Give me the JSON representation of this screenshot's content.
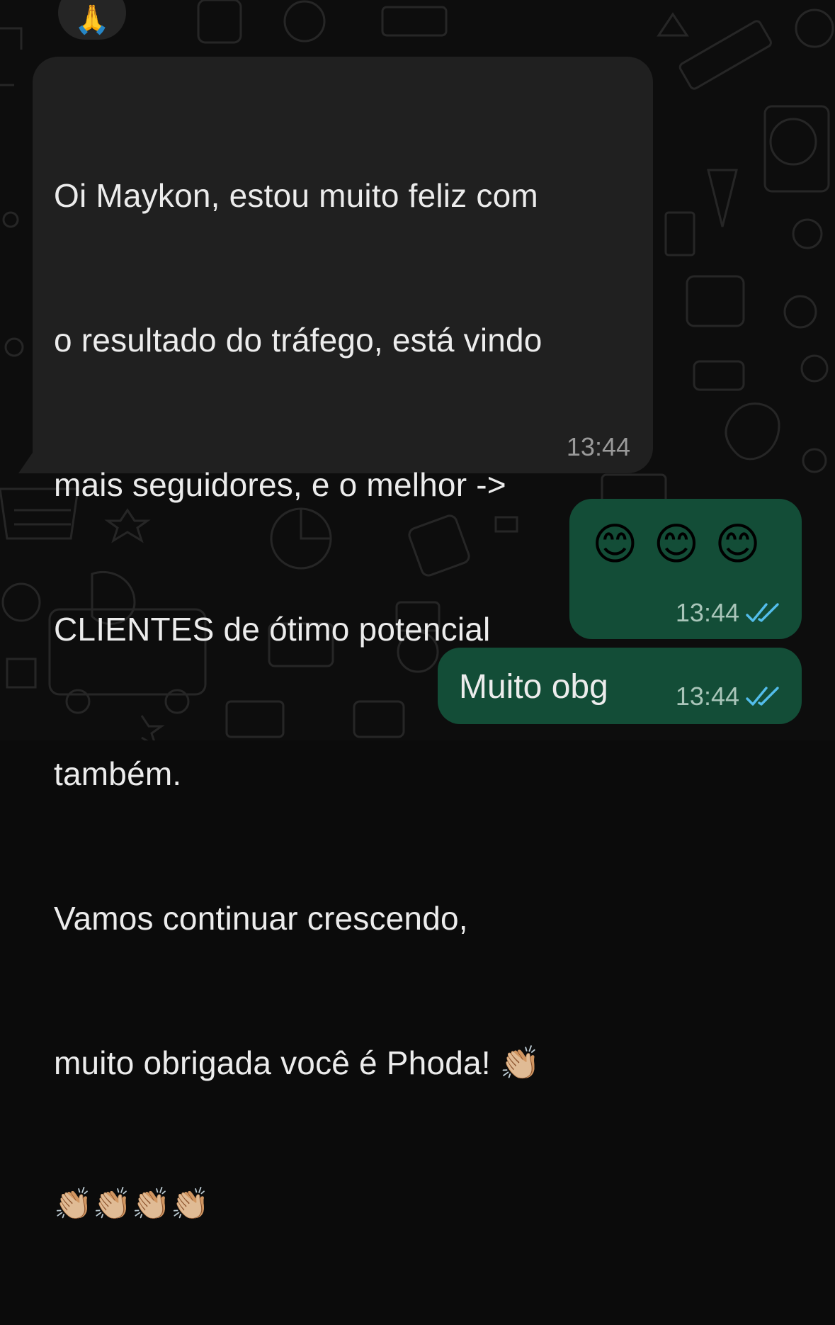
{
  "incoming": {
    "reaction": "🙏",
    "lines": [
      "Oi Maykon, estou muito feliz com",
      "o resultado do tráfego, está vindo",
      "mais seguidores, e o melhor ->",
      "CLIENTES de ótimo potencial",
      "também.",
      "Vamos continuar crescendo,",
      "muito obrigada você é Phoda! 👏🏼"
    ],
    "emoji_line": "👏🏼👏🏼👏🏼👏🏼",
    "time": "13:44"
  },
  "outgoing": [
    {
      "text": "😊😊😊",
      "time": "13:44",
      "status": "read"
    },
    {
      "text": "Muito obg",
      "time": "13:44",
      "status": "read"
    }
  ],
  "colors": {
    "background": "#0d0d0d",
    "incoming_bubble": "#202020",
    "outgoing_bubble": "#134d37",
    "read_ticks": "#53bdeb"
  }
}
